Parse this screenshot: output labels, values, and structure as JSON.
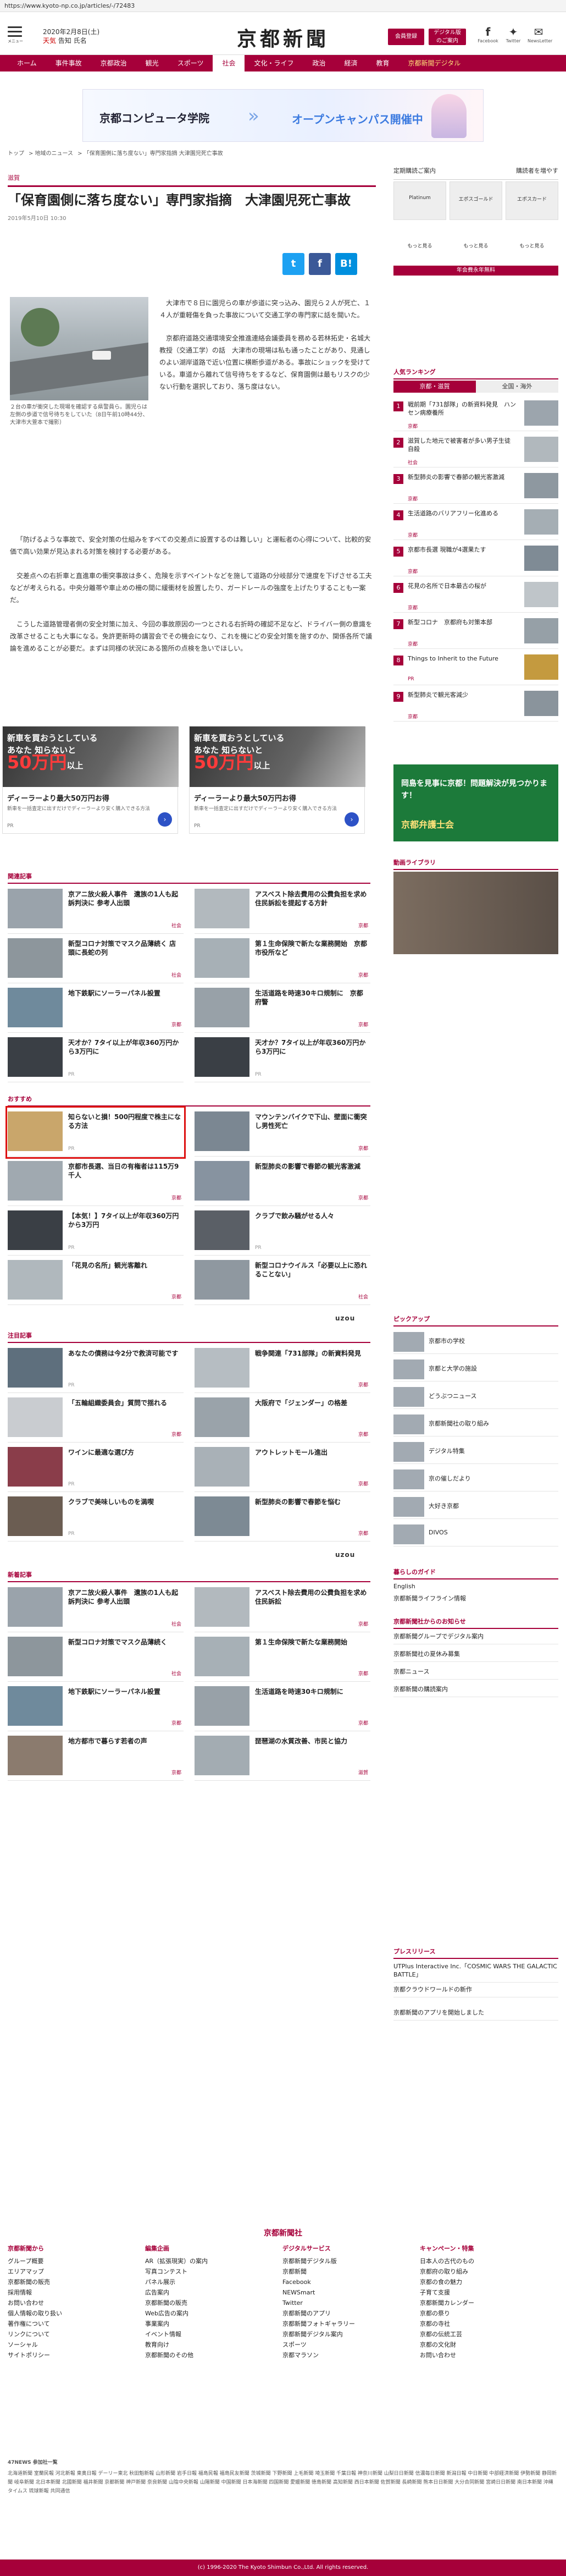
{
  "url": "https://www.kyoto-np.co.jp/articles/-/72483",
  "header": {
    "menu_label": "メニュー",
    "date": "2020年2月8日(土)",
    "weather": "天気",
    "weather2": "告知",
    "weather3": "氏名",
    "logo": "京都新聞",
    "login": "会員登録",
    "member": "デジタル版 のご案内",
    "facebook": "Facebook",
    "twitter": "Twitter",
    "youtube": "NewsLetter"
  },
  "nav": [
    "ホーム",
    "事件事故",
    "京都政治",
    "観光",
    "スポーツ",
    "社会",
    "文化・ライフ",
    "政治",
    "経済",
    "教育",
    "京都新聞デジタル"
  ],
  "top_ad": {
    "school": "京都コンピュータ学院",
    "open": "オープンキャンパス開催中"
  },
  "breadcrumb": [
    "トップ",
    "地域のニュース",
    "「保育園側に落ち度ない」専門家指摘 大津園児死亡事故"
  ],
  "article": {
    "category": "滋賀",
    "title": "「保育園側に落ち度ない」専門家指摘　大津園児死亡事故",
    "date": "2019年5月10日 10:30",
    "caption": "２台の車が衝突した現場を確認する県警員ら。園児らは左側の歩道で信号待ちをしていた（8日午前10時44分、大津市大萱本で撮影）",
    "p1": "大津市で８日に園児らの車が歩道に突っ込み、園児ら２人が死亡、１４人が重軽傷を負った事故について交通工学の専門家に話を聞いた。",
    "p2": "京都府道路交通環境安全推進連絡会議委員を務める若林拓史・名城大教授（交通工学）の話　大津市の現場は私も通ったことがあり、見通しのよい湖岸道路で近い位置に横断歩道がある。事故にショックを受けている。車道から離れて信号待ちをするなど、保育園側は最もリスクの少ない行動を選択しており、落ち度はない。",
    "p3": "「防げるような事故で、安全対策の仕組みをすべての交差点に設置するのは難しい」と運転者の心得について、比較的安価で高い効果が見込まれる対策を検討する必要がある。",
    "p4": "交差点への右折車と直進車の衝突事故は多く、危険を示すペイントなどを施して道路の分岐部分で速度を下げさせる工夫などが考えられる。中央分離帯や車止めの柵の間に緩衝材を設置したり、ガードレールの強度を上げたりすることも一案だ。",
    "p5": "こうした道路管理者側の安全対策に加え、今回の事故原因の一つとされる右折時の確認不足など、ドライバー側の意識を改革させることも大事になる。免許更新時の講習会でその機会になり、これを機にどの安全対策を施すのか、関係各所で議論を進めることが必要だ。まずは同様の状況にある箇所の点検を急いでほしい。"
  },
  "share": [
    "t",
    "f",
    "B!"
  ],
  "ads": [
    {
      "big1": "新車を買おうとしている",
      "big2": "あなた 知らないと",
      "big3": "50万円",
      "big4": "以上",
      "big5": "損をすることがあります",
      "line1": "ディーラーより最大50万円お得",
      "line2": "新車を一括査定に出すだけでディーラーより安く購入できる方法",
      "brand": "PR"
    },
    {
      "big1": "新車を買おうとしている",
      "big2": "あなた 知らないと",
      "big3": "50万円",
      "big4": "以上",
      "big5": "損をすることがあります",
      "line1": "ディーラーより最大50万円お得",
      "line2": "新車を一括査定に出すだけでディーラーより安く購入できる方法",
      "brand": "PR"
    }
  ],
  "sections": {
    "related": "関連記事",
    "recommend": "おすすめ",
    "attention": "注目記事",
    "newest": "新着記事",
    "ranking": "人気ランキング",
    "photo_lib": "動画ライブラリ",
    "pickup": "ピックアップ",
    "life": "暮らしのガイド",
    "news_release": "京都新聞社からのお知らせ",
    "press": "プレスリリース"
  },
  "related": [
    {
      "title": "京アニ放火殺人事件　遺族の1人も起訴判決に 参考人出頭",
      "meta": "社会"
    },
    {
      "title": "アスベスト除去費用の公費負担を求め住民訴訟を提起する方針",
      "meta": "京都"
    },
    {
      "title": "新型コロナ対策でマスク品薄続く 店頭に長蛇の列",
      "meta": "社会"
    },
    {
      "title": "第１生命保険で新たな業務開始　京都市役所など",
      "meta": "京都"
    },
    {
      "title": "地下鉄駅にソーラーパネル設置",
      "meta": "京都"
    },
    {
      "title": "生活道路を時速30キロ規制に　京都府警",
      "meta": "京都"
    },
    {
      "title": "天才か？7タイ以上が年収360万円から3万円に",
      "meta": "PR"
    },
    {
      "title": "天才か？7タイ以上が年収360万円から3万円に",
      "meta": "PR"
    }
  ],
  "recommend": [
    {
      "title": "知らないと損！500円程度で株主になる方法",
      "meta": "PR"
    },
    {
      "title": "マウンテンバイクで下山、壁面に衝突し男性死亡",
      "meta": "京都"
    },
    {
      "title": "京都市長選、当日の有権者は115万9千人",
      "meta": "京都"
    },
    {
      "title": "新型肺炎の影響で春節の観光客激減",
      "meta": "京都"
    },
    {
      "title": "【本気！】7タイ以上が年収360万円から3万円",
      "meta": "PR"
    },
    {
      "title": "クラブで飲み騒がせる人々",
      "meta": "PR"
    },
    {
      "title": "「花見の名所」観光客離れ",
      "meta": "京都"
    },
    {
      "title": "新型コロナウイルス「必要以上に恐れることない」",
      "meta": "社会"
    }
  ],
  "attention": [
    {
      "title": "あなたの債務は今2分で救済可能です",
      "meta": "PR"
    },
    {
      "title": "戦争関連「731部隊」の新資料発見",
      "meta": "京都"
    },
    {
      "title": "「五輪組織委員会」質問で揺れる",
      "meta": "京都"
    },
    {
      "title": "大阪府で「ジェンダー」の格差",
      "meta": "京都"
    },
    {
      "title": "ワインに最適な選び方",
      "meta": "PR"
    },
    {
      "title": "アウトレットモール進出",
      "meta": "京都"
    },
    {
      "title": "クラブで美味しいものを満喫",
      "meta": "PR"
    },
    {
      "title": "新型肺炎の影響で春節を悩む",
      "meta": "京都"
    }
  ],
  "newest": [
    {
      "title": "京アニ放火殺人事件　遺族の1人も起訴判決に 参考人出頭",
      "meta": "社会"
    },
    {
      "title": "アスベスト除去費用の公費負担を求め住民訴訟",
      "meta": "京都"
    },
    {
      "title": "新型コロナ対策でマスク品薄続く",
      "meta": "社会"
    },
    {
      "title": "第１生命保険で新たな業務開始",
      "meta": "京都"
    },
    {
      "title": "地下鉄駅にソーラーパネル設置",
      "meta": "京都"
    },
    {
      "title": "生活道路を時速30キロ規制に",
      "meta": "京都"
    },
    {
      "title": "地方都市で暮らす若者の声",
      "meta": "京都"
    },
    {
      "title": "琵琶湖の水質改善、市民と協力",
      "meta": "滋賀"
    }
  ],
  "side": {
    "link1": "定期購読ご案内",
    "link2": "購読者を増やす",
    "tiles": [
      "Platinum",
      "エポスゴールド",
      "エポスカード"
    ],
    "tile_caps": [
      "もっと見る",
      "もっと見る",
      "もっと見る"
    ],
    "tile_bar": "年会費永年無料",
    "rank_tab1": "京都・滋賀",
    "rank_tab2": "全国・海外",
    "ranking": [
      {
        "text": "戦前期「731部隊」の新資料発見　ハンセン病療養所",
        "tag": "京都"
      },
      {
        "text": "滋賀した地元で被害者が多い男子生徒 自殺",
        "tag": "社会"
      },
      {
        "text": "新型肺炎の影響で春節の観光客激減",
        "tag": "京都"
      },
      {
        "text": "生活道路のバリアフリー化進める",
        "tag": "京都"
      },
      {
        "text": "京都市長選 現職が4選果たす",
        "tag": "京都"
      },
      {
        "text": "花見の名所で日本最古の桜が",
        "tag": "京都"
      },
      {
        "text": "新型コロナ　京都府も対策本部",
        "tag": "京都"
      },
      {
        "text": "Things to Inherit to the Future",
        "tag": "PR"
      },
      {
        "text": "新型肺炎で観光客減少",
        "tag": "京都"
      }
    ],
    "ad_text": "岡島を見事に京都！問題解決が見つかります！",
    "ad_brand": "京都弁護士会",
    "pickup": [
      "京都市の学校",
      "京都と大学の施設",
      "どうぶつニュース",
      "京都新聞社の取り組み",
      "デジタル特集",
      "京の催しだより",
      "大好き京都",
      "DIVOS"
    ],
    "life": [
      "English",
      "京都新聞ライフライン情報"
    ],
    "news": [
      "京都新聞グループでデジタル案内",
      "京都新聞社の夏休み募集",
      "京都ニュース",
      "京都新聞の購読案内"
    ],
    "press": [
      "UTPlus Interactive Inc.「COSMIC WARS THE GALACTIC BATTLE」",
      "京都クラウドワールドの新作",
      "京都新聞のアプリを開始しました"
    ]
  },
  "footer": {
    "logo": "京都新聞社",
    "col1_head": "京都新聞から",
    "col1": [
      "グループ概要",
      "エリアマップ",
      "京都新聞の販売",
      "採用情報",
      "お問い合わせ",
      "個人情報の取り扱い",
      "著作権について",
      "リンクについて",
      "ソーシャル",
      "サイトポリシー"
    ],
    "col2_head": "編集企画",
    "col2": [
      "AR（拡張現実）の案内",
      "写真コンテスト",
      "パネル展示",
      "広告案内",
      "京都新聞の販売",
      "Web広告の案内",
      "事業案内",
      "イベント情報",
      "教育向け",
      "京都新聞のその他"
    ],
    "col3_head": "デジタルサービス",
    "col3": [
      "京都新聞デジタル版",
      "京都新聞",
      "Facebook",
      "NEWSmart",
      "Twitter",
      "京都新聞のアプリ",
      "京都新聞フォトギャラリー",
      "京都新聞デジタル案内",
      "スポーツ",
      "京都マラソン"
    ],
    "col4_head": "キャンペーン・特集",
    "col4": [
      "日本人の古代のもの",
      "京都府の取り組み",
      "京都の食の魅力",
      "子育て支援",
      "京都新聞カレンダー",
      "京都の祭り",
      "京都の寺社",
      "京都の伝統工芸",
      "京都の文化財",
      "お問い合わせ"
    ],
    "net_title": "47NEWS 参加社一覧",
    "net": "北海道新聞 室蘭民報 河北新報 東奥日報 デーリー東北 秋田魁新報 山形新聞 岩手日報 福島民報 福島民友新聞 茨城新聞 下野新聞 上毛新聞 埼玉新聞 千葉日報 神奈川新聞 山梨日日新聞 信濃毎日新聞 新潟日報 中日新聞 中部経済新聞 伊勢新聞 静岡新聞 岐阜新聞 北日本新聞 北國新聞 福井新聞 京都新聞 神戸新聞 奈良新聞 山陰中央新報 山陽新聞 中国新聞 日本海新聞 四国新聞 愛媛新聞 徳島新聞 高知新聞 西日本新聞 佐賀新聞 長崎新聞 熊本日日新聞 大分合同新聞 宮崎日日新聞 南日本新聞 沖縄タイムス 琉球新報 共同通信",
    "copyright": "(c) 1996-2020 The Kyoto Shimbun Co.,Ltd. All rights reserved."
  },
  "colors": {
    "brand": "#a6003a",
    "twitter": "#1da1f2",
    "facebook": "#3b5998",
    "hatena": "#008fde"
  }
}
